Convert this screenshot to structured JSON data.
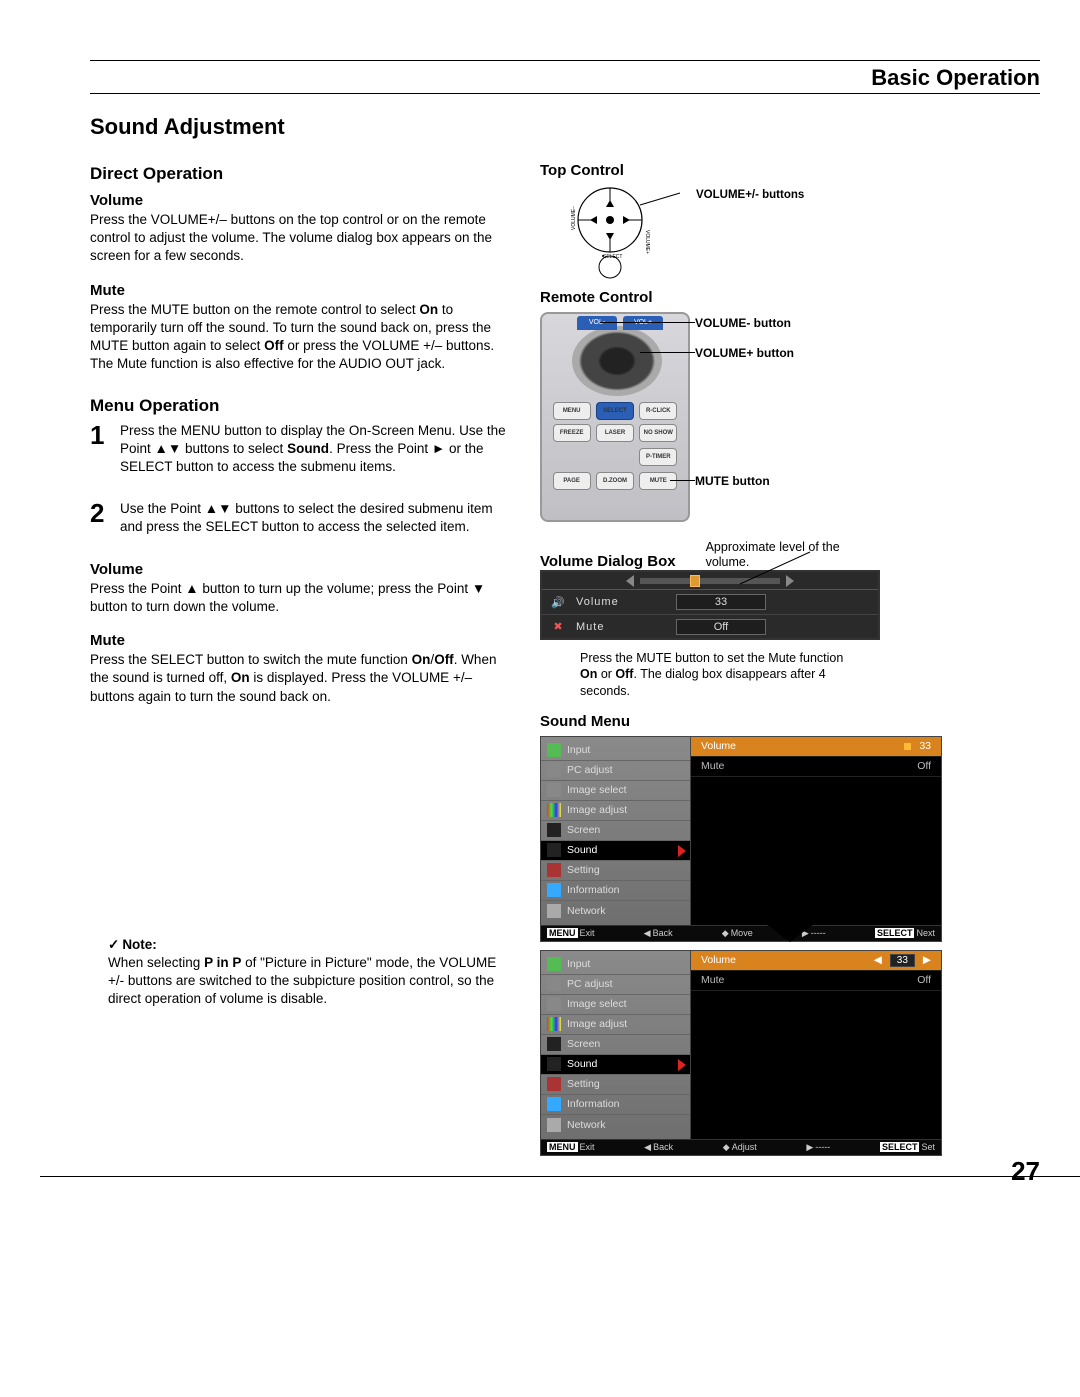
{
  "header": {
    "title": "Basic Operation"
  },
  "page_number": "27",
  "section_title": "Sound Adjustment",
  "direct": {
    "heading": "Direct Operation",
    "volume": {
      "label": "Volume",
      "text": "Press the VOLUME+/– buttons on the top control or on the remote control to adjust the volume. The volume dialog box appears on the screen for a few seconds."
    },
    "mute": {
      "label": "Mute",
      "text_before": "Press the MUTE button on the remote control to select ",
      "on": "On",
      "text_mid": " to temporarily turn off the sound. To turn the sound back on, press the MUTE button again to select ",
      "off": "Off",
      "text_after": " or press the VOLUME +/– buttons. The Mute function is also effective for the AUDIO OUT jack."
    }
  },
  "menu": {
    "heading": "Menu Operation",
    "steps": [
      {
        "n": "1",
        "before": "Press the MENU button to display the On-Screen Menu. Use the Point ▲▼ buttons to select ",
        "b1": "Sound",
        "after": ". Press the Point ► or the SELECT button to access the submenu items."
      },
      {
        "n": "2",
        "text": "Use the Point ▲▼ buttons to select the desired submenu item and press the SELECT button to access the selected item."
      }
    ],
    "volume": {
      "label": "Volume",
      "text": "Press the Point ▲ button to turn up the volume; press the Point ▼ button to turn down the volume."
    },
    "mute": {
      "label": "Mute",
      "t1": "Press the SELECT button to switch the mute function ",
      "on": "On",
      "slash": "/",
      "off": "Off",
      "t2": ". When the sound is turned off, ",
      "on2": "On",
      "t3": " is displayed. Press the VOLUME +/– buttons again to turn the sound back on."
    }
  },
  "note": {
    "label": "Note:",
    "t1": "When selecting ",
    "b1": "P in P",
    "t2": " of \"Picture in Picture\" mode, the VOLUME +/- buttons are switched to the subpicture position control, so the direct operation of volume is disable."
  },
  "right": {
    "top_control": {
      "caption": "Top Control",
      "label": "VOLUME+/- buttons",
      "select_text": "SELECT",
      "vol_minus": "VOLUME−",
      "vol_plus": "VOLUME+"
    },
    "remote": {
      "caption": "Remote Control",
      "labels": {
        "vminus": "VOLUME- button",
        "vplus": "VOLUME+ button",
        "mute": "MUTE button"
      },
      "buttons": {
        "menu": "MENU",
        "select": "SELECT",
        "rclick": "R-CLICK",
        "freeze": "FREEZE",
        "laser": "LASER",
        "noshow": "NO SHOW",
        "ptimer": "P-TIMER",
        "page": "PAGE",
        "dzoom": "D.ZOOM",
        "mute": "MUTE"
      }
    },
    "dialog": {
      "caption": "Volume Dialog Box",
      "approx": "Approximate level of the volume.",
      "rows": [
        {
          "icon": "🔊",
          "label": "Volume",
          "value": "33"
        },
        {
          "icon": "✖",
          "label": "Mute",
          "value": "Off"
        }
      ],
      "note_t1": "Press the MUTE button to set the Mute function ",
      "note_on": "On",
      "note_or": " or ",
      "note_off": "Off",
      "note_t2": ". The dialog box disappears after 4 seconds."
    },
    "soundmenu": {
      "caption": "Sound Menu",
      "side_items": [
        {
          "icon": "green",
          "label": "Input"
        },
        {
          "icon": "gray",
          "label": "PC adjust"
        },
        {
          "icon": "gray",
          "label": "Image select"
        },
        {
          "icon": "mc",
          "label": "Image adjust"
        },
        {
          "icon": "blk",
          "label": "Screen"
        },
        {
          "icon": "blk",
          "label": "Sound",
          "sel": true
        },
        {
          "icon": "red",
          "label": "Setting"
        },
        {
          "icon": "info",
          "label": "Information"
        },
        {
          "icon": "net",
          "label": "Network"
        }
      ],
      "main_volume_label": "Volume",
      "main_volume_value": "33",
      "main_mute_label": "Mute",
      "main_mute_value": "Off",
      "foot1": {
        "exit": "Exit",
        "back": "Back",
        "move": "Move",
        "dash": "-----",
        "next": "Next",
        "menu": "MENU",
        "sel": "SELECT"
      },
      "foot2": {
        "exit": "Exit",
        "back": "Back",
        "adjust": "Adjust",
        "dash": "-----",
        "set": "Set",
        "menu": "MENU",
        "sel": "SELECT"
      }
    }
  }
}
